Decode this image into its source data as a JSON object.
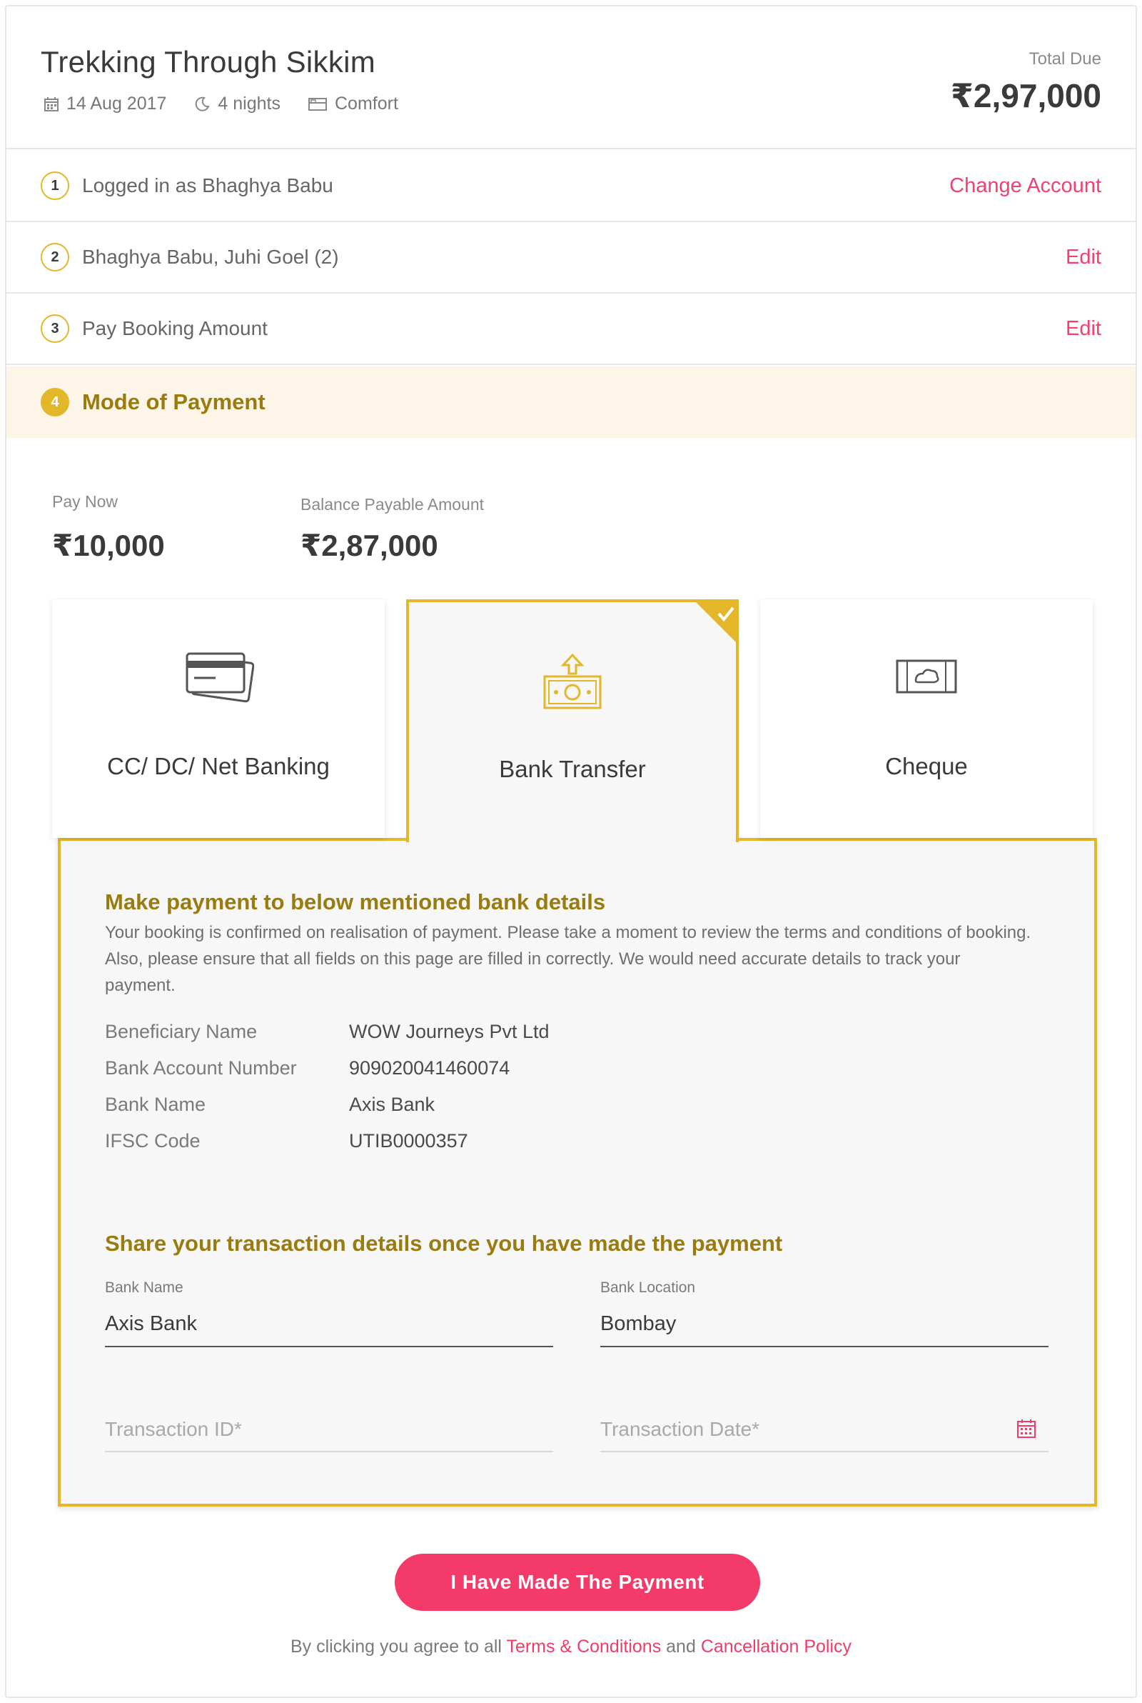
{
  "trip": {
    "title": "Trekking Through Sikkim",
    "date": "14 Aug 2017",
    "nights": "4 nights",
    "category": "Comfort",
    "total_label": "Total Due",
    "total_value": "₹2,97,000"
  },
  "steps": [
    {
      "num": "1",
      "label": "Logged in as Bhaghya Babu",
      "action": "Change Account"
    },
    {
      "num": "2",
      "label": "Bhaghya Babu, Juhi Goel (2)",
      "action": "Edit"
    },
    {
      "num": "3",
      "label": "Pay Booking Amount",
      "action": "Edit"
    },
    {
      "num": "4",
      "label": "Mode of Payment"
    }
  ],
  "amounts": {
    "pay_now_label": "Pay Now",
    "pay_now_value": "₹10,000",
    "balance_label": "Balance Payable Amount",
    "balance_value": "₹2,87,000"
  },
  "payment_modes": [
    {
      "label": "CC/ DC/ Net Banking",
      "icon": "credit-card-icon",
      "selected": false
    },
    {
      "label": "Bank Transfer",
      "icon": "bank-transfer-icon",
      "selected": true
    },
    {
      "label": "Cheque",
      "icon": "cheque-icon",
      "selected": false
    }
  ],
  "bank_panel": {
    "heading": "Make payment to below mentioned bank details",
    "description": "Your booking is confirmed on realisation of payment. Please take a moment to review the terms and conditions of booking. Also, please ensure that all fields on this page are filled in correctly. We would need accurate details to track your payment.",
    "details": [
      {
        "key": "Beneficiary Name",
        "value": "WOW Journeys Pvt Ltd"
      },
      {
        "key": "Bank Account Number",
        "value": "909020041460074"
      },
      {
        "key": "Bank Name",
        "value": "Axis Bank"
      },
      {
        "key": "IFSC Code",
        "value": "UTIB0000357"
      }
    ],
    "share_heading": "Share your transaction details once you have made the payment",
    "fields": {
      "bank_name_label": "Bank Name",
      "bank_name_value": "Axis Bank",
      "bank_location_label": "Bank Location",
      "bank_location_value": "Bombay",
      "transaction_id_placeholder": "Transaction ID*",
      "transaction_date_placeholder": "Transaction Date*"
    }
  },
  "submit": {
    "label": "I Have Made The Payment"
  },
  "terms": {
    "prefix": "By clicking you agree to all ",
    "terms_link": "Terms & Conditions",
    "middle": " and ",
    "cancellation_link": "Cancellation Policy"
  },
  "colors": {
    "accent_gold": "#e3b729",
    "heading_gold": "#9a7b0d",
    "brand_pink": "#f33a68",
    "active_step_bg": "#fdf5e7"
  }
}
